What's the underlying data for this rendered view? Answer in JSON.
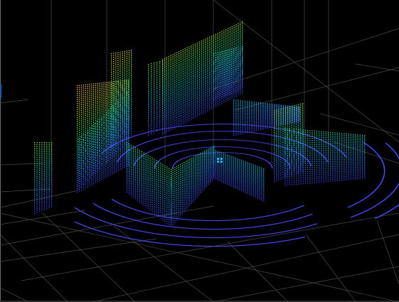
{
  "viewer": {
    "type": "point-cloud-3d",
    "grid": true,
    "background": "#000000",
    "grid_color": "#4a4a4a",
    "colormap": [
      "#3b3bd8",
      "#2b8be8",
      "#1ec8c8",
      "#48e070",
      "#c8e040",
      "#f0c070"
    ],
    "sensor_marker_color": "#29b6f6"
  }
}
